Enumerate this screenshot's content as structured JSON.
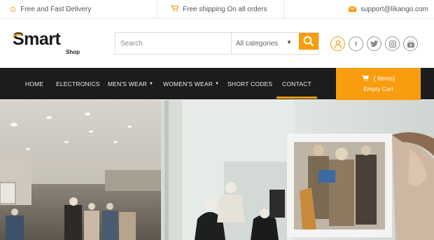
{
  "topbar": {
    "delivery": "Free and Fast Delivery",
    "shipping": "Free shipping On all orders",
    "email": "support@likango.com"
  },
  "logo": {
    "main": "Smart",
    "sub": "Shop"
  },
  "search": {
    "placeholder": "Search",
    "category": "All categories"
  },
  "social_icons": [
    "user-icon",
    "facebook-icon",
    "twitter-icon",
    "instagram-icon",
    "youtube-icon"
  ],
  "nav": {
    "items": [
      {
        "label": "HOME",
        "has_dropdown": false
      },
      {
        "label": "ELECTRONICS",
        "has_dropdown": false
      },
      {
        "label": "MEN'S WEAR",
        "has_dropdown": true
      },
      {
        "label": "WOMEN'S WEAR",
        "has_dropdown": true
      },
      {
        "label": "SHORT CODES",
        "has_dropdown": false
      },
      {
        "label": "CONTACT",
        "has_dropdown": false,
        "active": true
      }
    ]
  },
  "cart": {
    "items_text": "( Items)",
    "status": "Empty Cart"
  },
  "colors": {
    "accent": "#f99d0e",
    "nav_bg": "#1c1c1c"
  }
}
